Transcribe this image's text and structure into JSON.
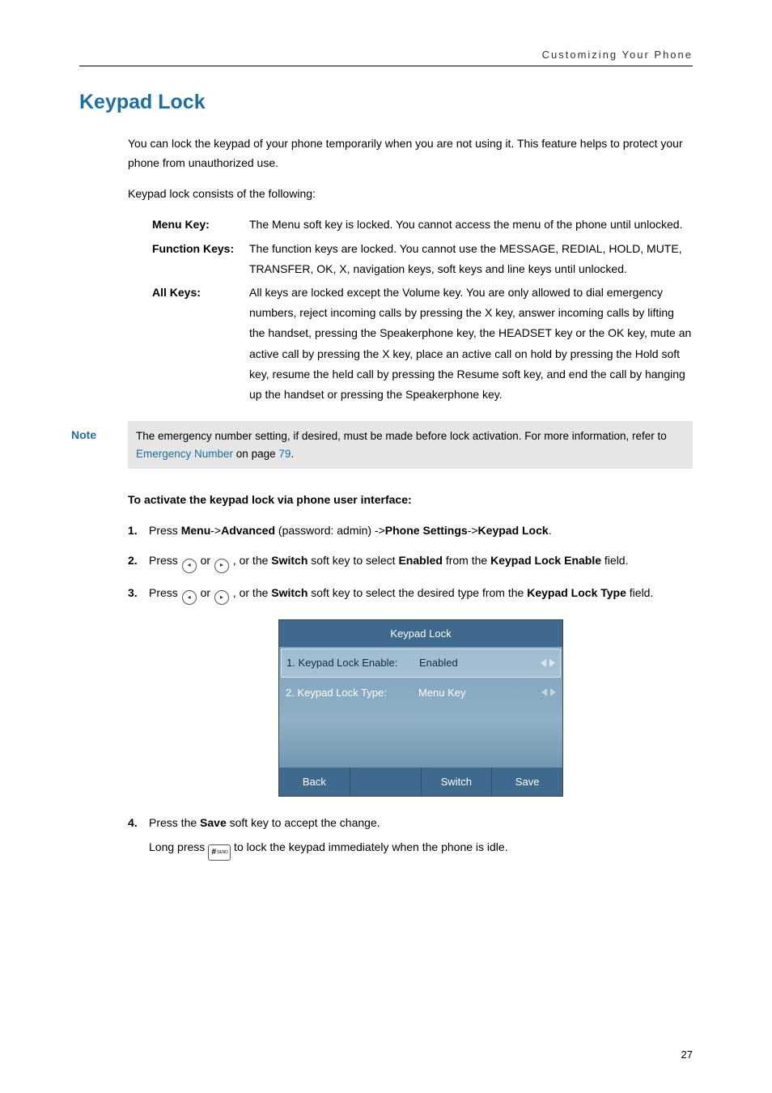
{
  "header": {
    "running_head": "Customizing Your Phone"
  },
  "title": "Keypad Lock",
  "intro1": "You can lock the keypad of your phone temporarily when you are not using it. This feature helps to protect your phone from unauthorized use.",
  "intro2": "Keypad lock consists of the following:",
  "defs": [
    {
      "label": "Menu Key:",
      "value": "The Menu soft key is locked. You cannot access the menu of the phone until unlocked."
    },
    {
      "label": "Function Keys:",
      "value": "The function keys are locked. You cannot use the MESSAGE, REDIAL, HOLD, MUTE, TRANSFER, OK, X, navigation keys, soft keys and line keys until unlocked."
    },
    {
      "label": "All Keys:",
      "value": "All keys are locked except the Volume key. You are only allowed to dial emergency numbers, reject incoming calls by pressing the X key, answer incoming calls by lifting the handset, pressing the Speakerphone key, the HEADSET key or the OK key, mute an active call by pressing the X key, place an active call on hold by pressing the Hold soft key, resume the held call by pressing the Resume soft key, and end the call by hanging up the handset or pressing the Speakerphone key."
    }
  ],
  "note": {
    "label": "Note",
    "text_before_link": "The emergency number setting, if desired, must be made before lock activation. For more information, refer to ",
    "link_text": "Emergency Number",
    "text_mid": " on page ",
    "page_ref": "79",
    "text_after": "."
  },
  "instr_heading": "To activate the keypad lock via phone user interface:",
  "steps": {
    "s1": {
      "a": "Press ",
      "b1": "Menu",
      "c": "->",
      "b2": "Advanced",
      "d": " (password: admin) ->",
      "b3": "Phone Settings",
      "e": "->",
      "b4": "Keypad Lock",
      "f": "."
    },
    "s2": {
      "a": "Press ",
      "b": " or ",
      "c": " , or the ",
      "b1": "Switch",
      "d": " soft key to select ",
      "b2": "Enabled",
      "e": " from the ",
      "b3": "Keypad Lock Enable",
      "f": " field."
    },
    "s3": {
      "a": "Press ",
      "b": " or ",
      "c": " , or the ",
      "b1": "Switch",
      "d": " soft key to select the desired type from the ",
      "b2": "Keypad Lock Type",
      "e": " field."
    },
    "s4": {
      "a": "Press the ",
      "b1": "Save",
      "b": " soft key to accept the change.",
      "cont1": "Long press ",
      "cont2": " to lock the keypad immediately when the phone is idle."
    }
  },
  "phone": {
    "title": "Keypad Lock",
    "rows": [
      {
        "label": "1. Keypad Lock Enable:",
        "value": "Enabled",
        "selected": true
      },
      {
        "label": "2. Keypad Lock Type:",
        "value": "Menu Key",
        "selected": false
      }
    ],
    "softkeys": [
      "Back",
      "",
      "Switch",
      "Save"
    ]
  },
  "page_number": "27"
}
